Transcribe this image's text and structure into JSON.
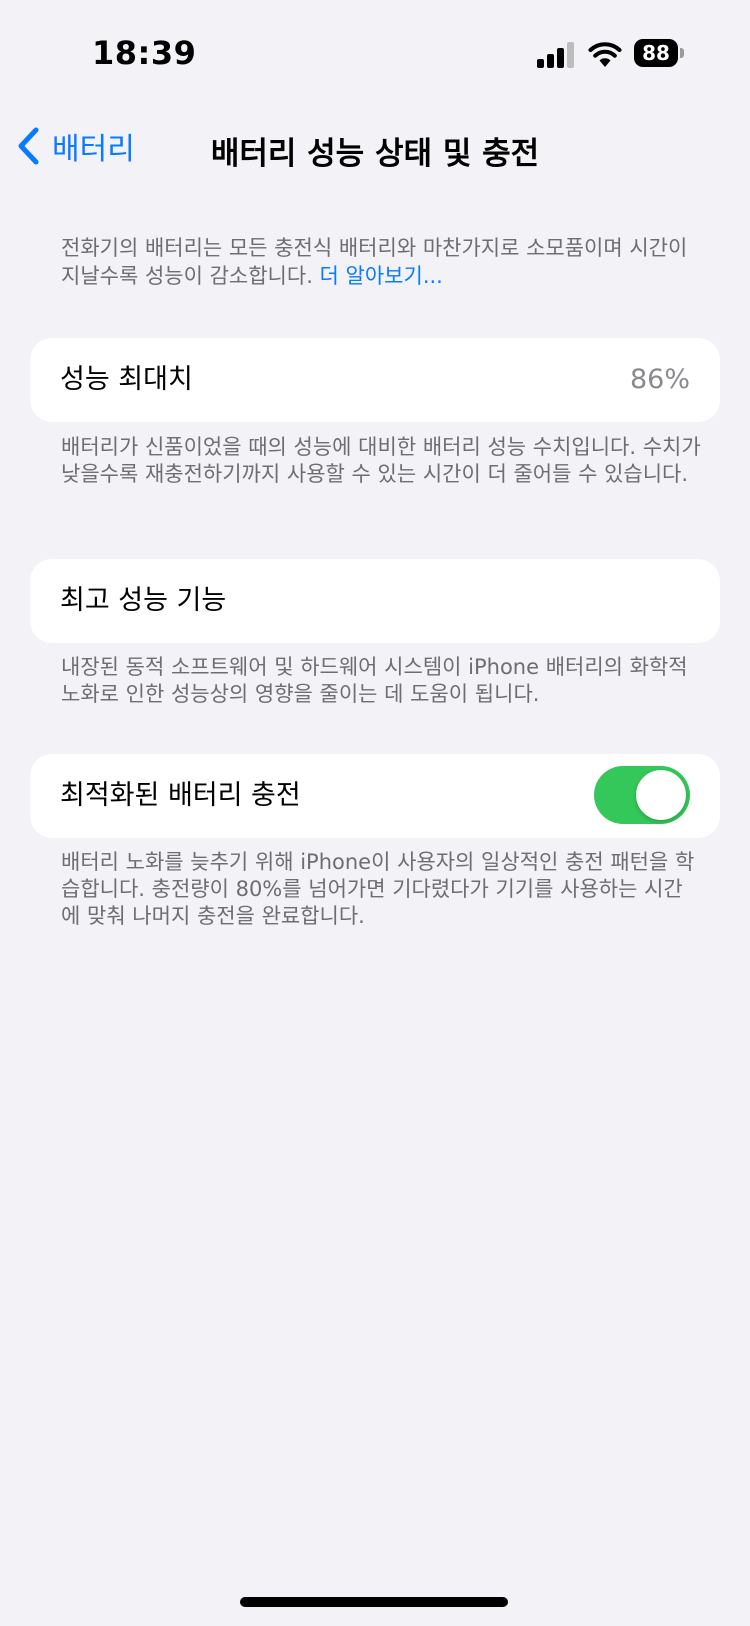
{
  "status_bar": {
    "time": "18:39",
    "battery_level": "88",
    "signal_bars": 3,
    "signal_bars_total": 4,
    "icons": [
      "cellular-signal-icon",
      "wifi-icon",
      "battery-icon"
    ]
  },
  "nav": {
    "back_label": "배터리",
    "title": "배터리 성능 상태 및 충전"
  },
  "intro": {
    "text": "전화기의 배터리는 모든 충전식 배터리와 마찬가지로 소모품이며 시간이 지날수록 성능이 감소합니다. ",
    "link": "더 알아보기..."
  },
  "sections": {
    "max_capacity": {
      "label": "성능 최대치",
      "value": "86%",
      "footnote": "배터리가 신품이었을 때의 성능에 대비한 배터리 성능 수치입니다. 수치가 낮을수록 재충전하기까지 사용할 수 있는 시간이 더 줄어들 수 있습니다."
    },
    "peak_performance": {
      "label": "최고 성능 기능",
      "footnote": "내장된 동적 소프트웨어 및 하드웨어 시스템이 iPhone 배터리의 화학적 노화로 인한 성능상의 영향을 줄이는 데 도움이 됩니다."
    },
    "optimized_charging": {
      "label": "최적화된 배터리 충전",
      "enabled": true,
      "footnote": "배터리 노화를 늦추기 위해 iPhone이 사용자의 일상적인 충전 패턴을 학습합니다. 충전량이 80%를 넘어가면 기다렸다가 기기를 사용하는 시간에 맞춰 나머지 충전을 완료합니다."
    }
  },
  "colors": {
    "background": "#f2f2f7",
    "accent": "#0a7aff",
    "toggle_on": "#34c759",
    "secondary_text": "#6d6d72"
  }
}
